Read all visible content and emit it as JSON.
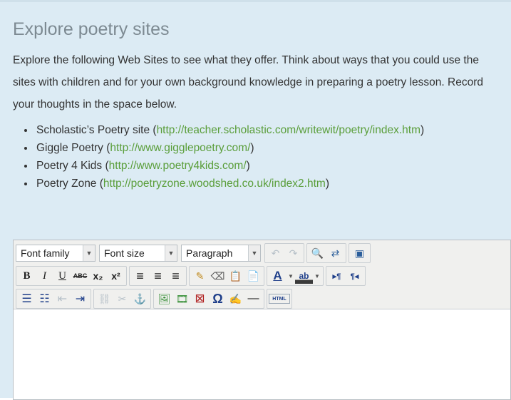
{
  "title": "Explore poetry sites",
  "intro": "Explore the following Web Sites to see what they offer. Think about ways that you could use the sites with children and for your own background knowledge in preparing a poetry lesson. Record your thoughts in the space below.",
  "sites": [
    {
      "name": "Scholastic’s Poetry site",
      "url": "http://teacher.scholastic.com/writewit/poetry/index.htm"
    },
    {
      "name": "Giggle Poetry",
      "url": "http://www.gigglepoetry.com/"
    },
    {
      "name": "Poetry 4 Kids",
      "url": "http://www.poetry4kids.com/"
    },
    {
      "name": "Poetry Zone",
      "url": "http://poetryzone.woodshed.co.uk/index2.htm"
    }
  ],
  "editor": {
    "font_family": "Font family",
    "font_size": "Font size",
    "format": "Paragraph",
    "icons": {
      "undo": "↶",
      "redo": "↷",
      "find": "🔍",
      "replace": "⇄",
      "fullscreen": "▣",
      "bold": "B",
      "italic": "I",
      "underline": "U",
      "strike": "ABC",
      "sub": "x₂",
      "sup": "x²",
      "align_left": "≡",
      "align_center": "≡",
      "align_right": "≡",
      "clean": "✎",
      "eraser": "⌫",
      "paste_text": "📋",
      "paste_word": "📄",
      "font_color": "A",
      "highlight": "ab",
      "ltr": "▸¶",
      "rtl": "¶◂",
      "bullets": "☰",
      "numbers": "☷",
      "outdent": "⇤",
      "indent": "⇥",
      "link": "⛓",
      "unlink": "✂",
      "anchor": "⚓",
      "image": "🖼",
      "media": "🎞",
      "nonbreak": "⊠",
      "omega": "Ω",
      "edit": "✍",
      "hr": "—",
      "html": "HTML"
    },
    "content": ""
  }
}
